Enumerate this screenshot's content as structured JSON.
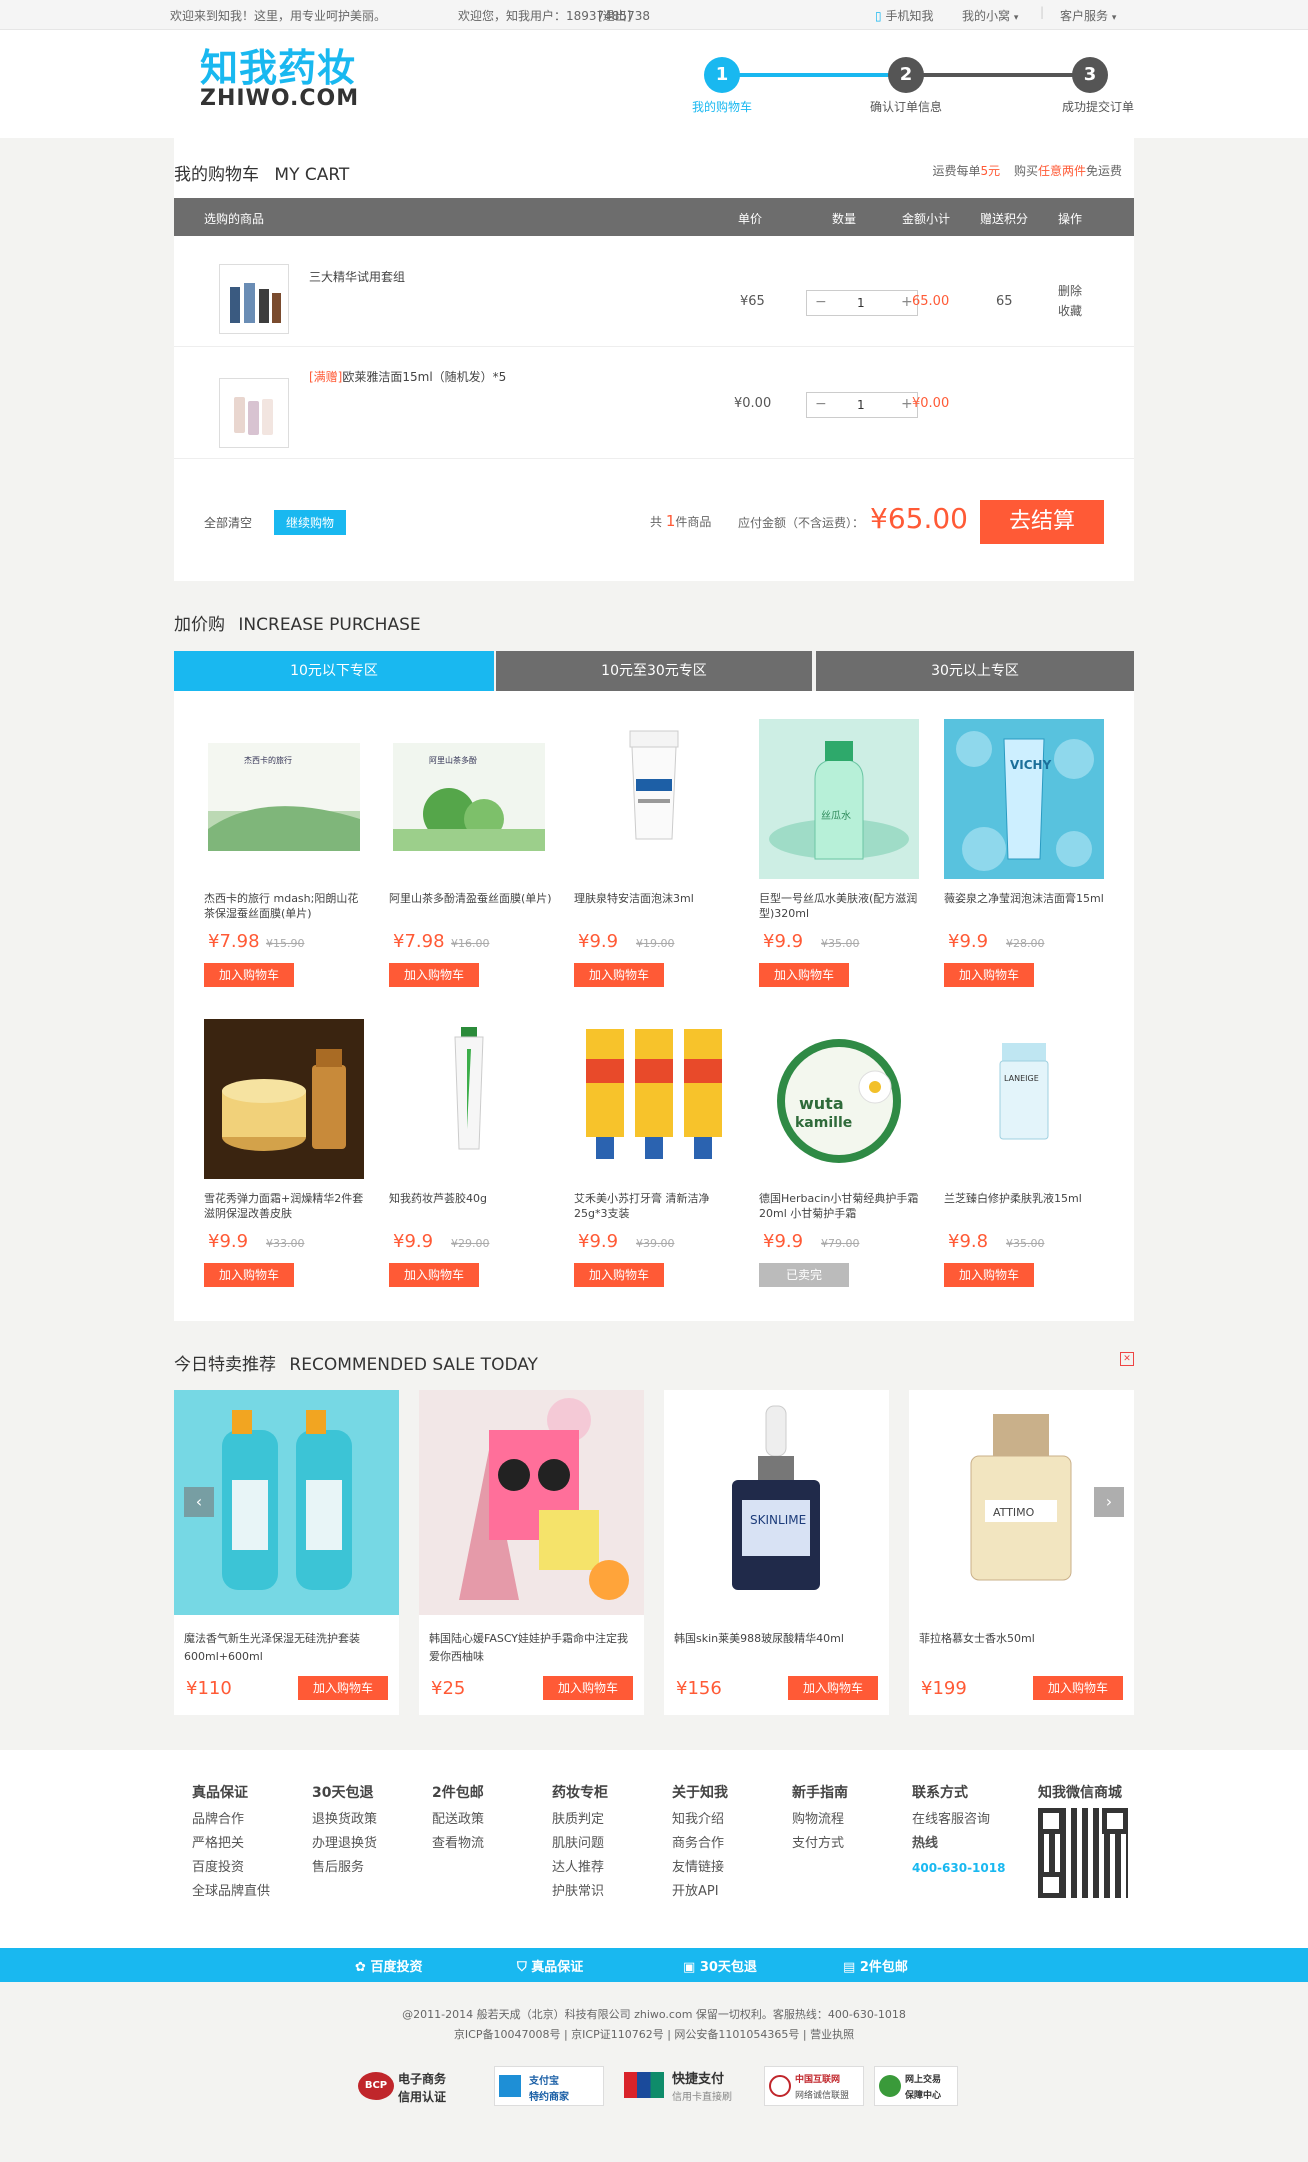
{
  "topbar": {
    "welcome": "欢迎来到知我！这里，用专业呵护美丽。",
    "greeting": "欢迎您，知我用户：18937485738",
    "logout": "[退出]",
    "mobile": "手机知我",
    "my_nest": "我的小窝",
    "service": "客户服务"
  },
  "header": {
    "logo_cn": "知我药妆",
    "logo_en": "ZHIWO.COM",
    "steps": [
      {
        "num": "1",
        "label": "我的购物车"
      },
      {
        "num": "2",
        "label": "确认订单信息"
      },
      {
        "num": "3",
        "label": "成功提交订单"
      }
    ]
  },
  "cart": {
    "title_cn": "我的购物车",
    "title_en": "MY CART",
    "shipping_prefix": "运费每单",
    "shipping_amount": "5元",
    "shipping_mid": "购买",
    "shipping_highlight": "任意两件",
    "shipping_suffix": "免运费",
    "columns": [
      "选购的商品",
      "单价",
      "数量",
      "金额小计",
      "赠送积分",
      "操作"
    ],
    "items": [
      {
        "name": "三大精华试用套组",
        "tag": "",
        "unit_price": "¥65",
        "qty": "1",
        "subtotal": "65.00",
        "points": "65",
        "ops": [
          "删除",
          "收藏"
        ]
      },
      {
        "name": "欧莱雅洁面15ml（随机发）*5",
        "tag": "[满赠]",
        "unit_price": "¥0.00",
        "qty": "1",
        "subtotal": "¥0.00",
        "points": "",
        "ops": []
      }
    ],
    "clear": "全部清空",
    "continue": "继续购物",
    "count_prefix": "共",
    "count": "1",
    "count_suffix": "件商品",
    "payable_label": "应付金额（不含运费）：",
    "total": "¥65.00",
    "checkout": "去结算"
  },
  "increase": {
    "title_cn": "加价购",
    "title_en": "INCREASE PURCHASE",
    "tabs": [
      "10元以下专区",
      "10元至30元专区",
      "30元以上专区"
    ],
    "add_label": "加入购物车",
    "sold_label": "已卖完",
    "products": [
      {
        "name": "杰西卡的旅行 mdash;阳朗山花茶保湿蚕丝面膜(单片)",
        "price": "¥7.98",
        "old": "¥15.90"
      },
      {
        "name": "阿里山茶多酚清盈蚕丝面膜(单片)",
        "price": "¥7.98",
        "old": "¥16.00"
      },
      {
        "name": "理肤泉特安洁面泡沫3ml",
        "price": "¥9.9",
        "old": "¥19.00"
      },
      {
        "name": "巨型一号丝瓜水美肤液(配方滋润型)320ml",
        "price": "¥9.9",
        "old": "¥35.00"
      },
      {
        "name": "薇姿泉之净莹润泡沫洁面膏15ml",
        "price": "¥9.9",
        "old": "¥28.00"
      },
      {
        "name": "雪花秀弹力面霜+润燥精华2件套 滋阴保湿改善皮肤",
        "price": "¥9.9",
        "old": "¥33.00"
      },
      {
        "name": "知我药妆芦荟胶40g",
        "price": "¥9.9",
        "old": "¥29.00"
      },
      {
        "name": "艾禾美小苏打牙膏 清新洁净25g*3支装",
        "price": "¥9.9",
        "old": "¥39.00"
      },
      {
        "name": "德国Herbacin小甘菊经典护手霜20ml 小甘菊护手霜",
        "price": "¥9.9",
        "old": "¥79.00"
      },
      {
        "name": "兰芝臻白修护柔肤乳液15ml",
        "price": "¥9.8",
        "old": "¥35.00"
      }
    ]
  },
  "recommend": {
    "title_cn": "今日特卖推荐",
    "title_en": "RECOMMENDED SALE TODAY",
    "add_label": "加入购物车",
    "items": [
      {
        "name": "魔法香气新生光泽保湿无硅洗护套装600ml+600ml",
        "price": "¥110"
      },
      {
        "name": "韩国陆心媛FASCY娃娃护手霜命中注定我爱你西柚味",
        "price": "¥25"
      },
      {
        "name": "韩国skin莱美988玻尿酸精华40ml",
        "price": "¥156"
      },
      {
        "name": "菲拉格慕女士香水50ml",
        "price": "¥199"
      }
    ]
  },
  "footer": {
    "columns": [
      {
        "title": "真品保证",
        "links": [
          "品牌合作",
          "严格把关",
          "百度投资",
          "全球品牌直供"
        ]
      },
      {
        "title": "30天包退",
        "links": [
          "退换货政策",
          "办理退换货",
          "售后服务"
        ]
      },
      {
        "title": "2件包邮",
        "links": [
          "配送政策",
          "查看物流"
        ]
      },
      {
        "title": "药妆专柜",
        "links": [
          "肤质判定",
          "肌肤问题",
          "达人推荐",
          "护肤常识"
        ]
      },
      {
        "title": "关于知我",
        "links": [
          "知我介绍",
          "商务合作",
          "友情链接",
          "开放API"
        ]
      },
      {
        "title": "新手指南",
        "links": [
          "购物流程",
          "支付方式"
        ]
      },
      {
        "title": "联系方式",
        "links": [
          "在线客服咨询",
          "热线"
        ]
      },
      {
        "title": "知我微信商城",
        "links": []
      }
    ],
    "hotline": "400-630-1018",
    "badges": [
      "百度投资",
      "真品保证",
      "30天包退",
      "2件包邮"
    ],
    "copyright": "@2011-2014 般若天成（北京）科技有限公司 zhiwo.com 保留一切权利。客服热线：400-630-1018",
    "icp": "京ICP备10047008号 | 京ICP证110762号 | 网公安备1101054365号 | 营业执照",
    "certs": [
      {
        "title": "电子商务",
        "sub": "信用认证"
      },
      {
        "title": "支付宝",
        "sub": "特约商家"
      },
      {
        "title": "快捷支付",
        "sub": "信用卡直接刷"
      },
      {
        "title": "中国互联网",
        "sub": "网络诚信联盟"
      },
      {
        "title": "网上交易",
        "sub": "保障中心"
      }
    ]
  },
  "colors": {
    "accent": "#19b8f0",
    "price": "#ff5a36",
    "dark_header": "#6d6d6d"
  }
}
